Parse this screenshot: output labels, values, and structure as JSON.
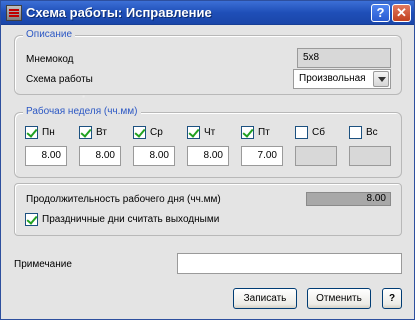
{
  "window": {
    "title": "Схема работы: Исправление",
    "help_glyph": "?",
    "close_glyph": "✕"
  },
  "description": {
    "legend": "Описание",
    "mnemocode_label": "Мнемокод",
    "mnemocode_value": "5x8",
    "schema_label": "Схема работы",
    "schema_value": "Произвольная"
  },
  "workweek": {
    "legend": "Рабочая неделя (чч.мм)",
    "days": [
      {
        "label": "Пн",
        "checked": true,
        "value": "8.00"
      },
      {
        "label": "Вт",
        "checked": true,
        "value": "8.00"
      },
      {
        "label": "Ср",
        "checked": true,
        "value": "8.00"
      },
      {
        "label": "Чт",
        "checked": true,
        "value": "8.00"
      },
      {
        "label": "Пт",
        "checked": true,
        "value": "7.00"
      },
      {
        "label": "Сб",
        "checked": false,
        "value": ""
      },
      {
        "label": "Вс",
        "checked": false,
        "value": ""
      }
    ]
  },
  "duration": {
    "label": "Продолжительность рабочего дня (чч.мм)",
    "value": "8.00",
    "holidays_label": "Праздничные дни считать выходными",
    "holidays_checked": true
  },
  "note": {
    "label": "Примечание",
    "value": ""
  },
  "buttons": {
    "save": "Записать",
    "cancel": "Отменить",
    "help": "?"
  }
}
